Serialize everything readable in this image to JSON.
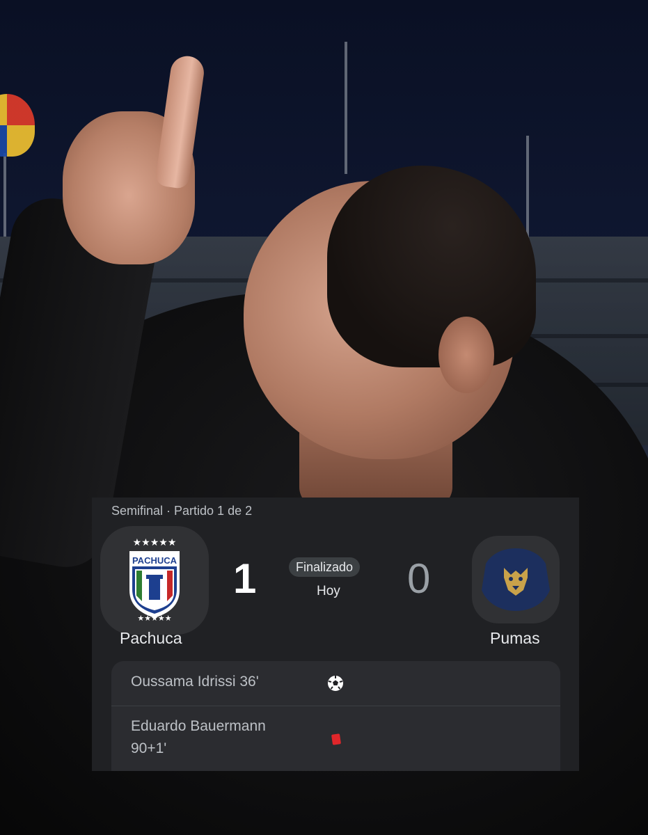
{
  "match": {
    "stage": "Semifinal · Partido 1 de 2",
    "status": "Finalizado",
    "day": "Hoy"
  },
  "home": {
    "name": "Pachuca",
    "score": "1",
    "logo_text": "PACHUCA"
  },
  "away": {
    "name": "Pumas",
    "score": "0"
  },
  "events": [
    {
      "player": "Oussama Idrissi 36'",
      "icon": "soccer-ball-icon"
    },
    {
      "player": "Eduardo Bauermann 90+1'",
      "icon": "red-card-icon"
    }
  ],
  "colors": {
    "card_bg": "#202124",
    "events_bg": "#2b2c30",
    "pumas_navy": "#1c2f5e",
    "pumas_gold": "#c9a24a",
    "red_card": "#e0262a",
    "pachuca_blue": "#1d3f8f"
  }
}
